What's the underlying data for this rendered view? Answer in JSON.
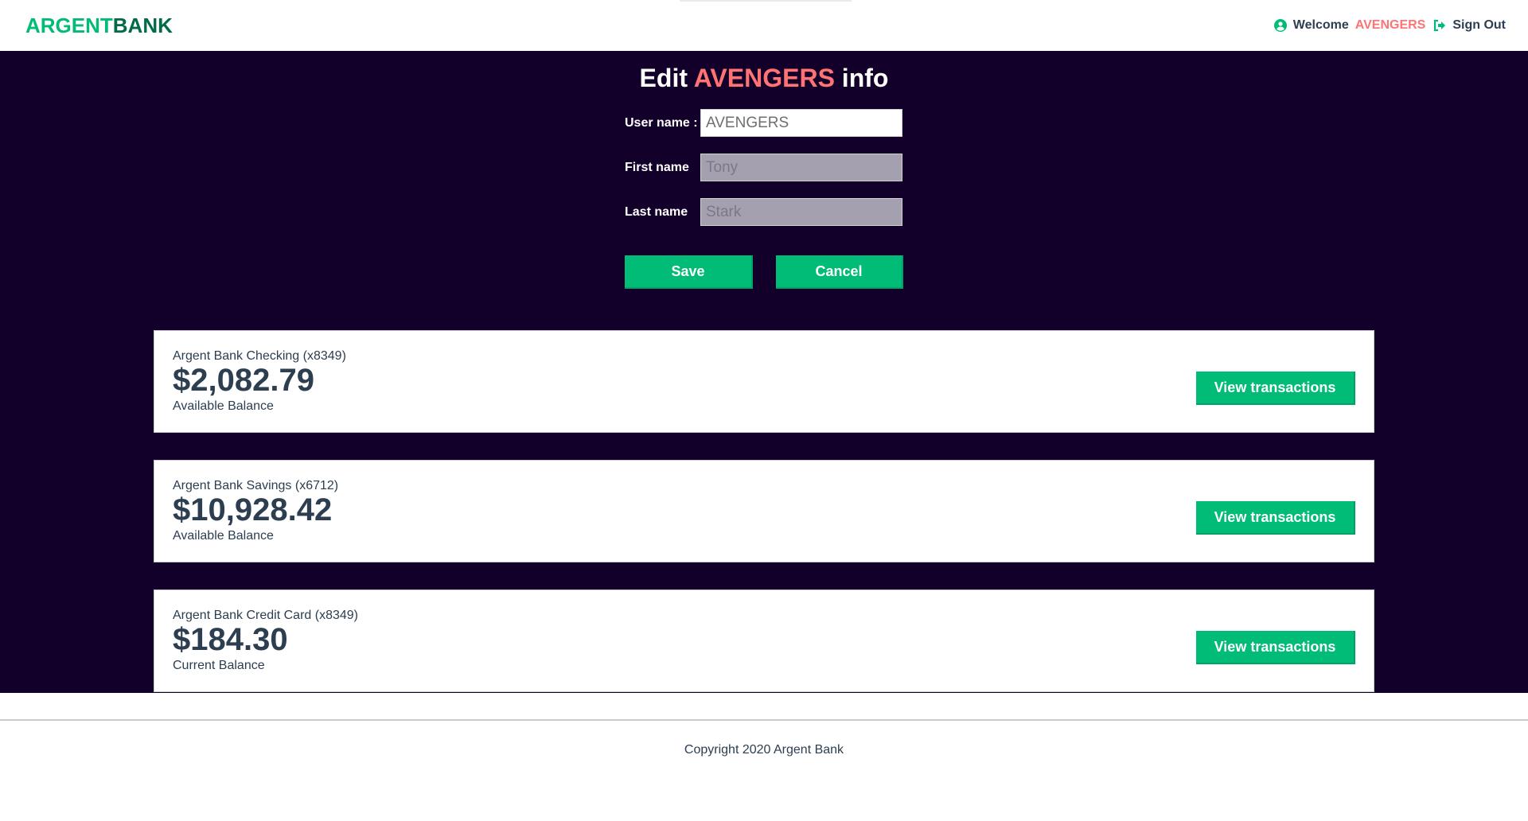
{
  "header": {
    "logo_part1": "ARGENT",
    "logo_part2": "BANK",
    "welcome_label": "Welcome",
    "user_name": "AVENGERS",
    "signout_label": "Sign Out"
  },
  "edit": {
    "title_prefix": "Edit",
    "title_name": "AVENGERS",
    "title_suffix": "info",
    "username_label": "User name :",
    "username_value": "AVENGERS",
    "firstname_label": "First name",
    "firstname_value": "Tony",
    "lastname_label": "Last name",
    "lastname_value": "Stark",
    "save_label": "Save",
    "cancel_label": "Cancel"
  },
  "accounts": [
    {
      "title": "Argent Bank Checking (x8349)",
      "amount": "$2,082.79",
      "description": "Available Balance",
      "button_label": "View transactions"
    },
    {
      "title": "Argent Bank Savings (x6712)",
      "amount": "$10,928.42",
      "description": "Available Balance",
      "button_label": "View transactions"
    },
    {
      "title": "Argent Bank Credit Card (x8349)",
      "amount": "$184.30",
      "description": "Current Balance",
      "button_label": "View transactions"
    }
  ],
  "footer": {
    "copyright": "Copyright 2020 Argent Bank"
  },
  "colors": {
    "brand_green": "#00bc77",
    "brand_dark_green": "#006b45",
    "highlight": "#ff7373",
    "main_background": "#12002b"
  },
  "icons": {
    "user": "user-circle-icon",
    "signout": "sign-out-icon"
  }
}
